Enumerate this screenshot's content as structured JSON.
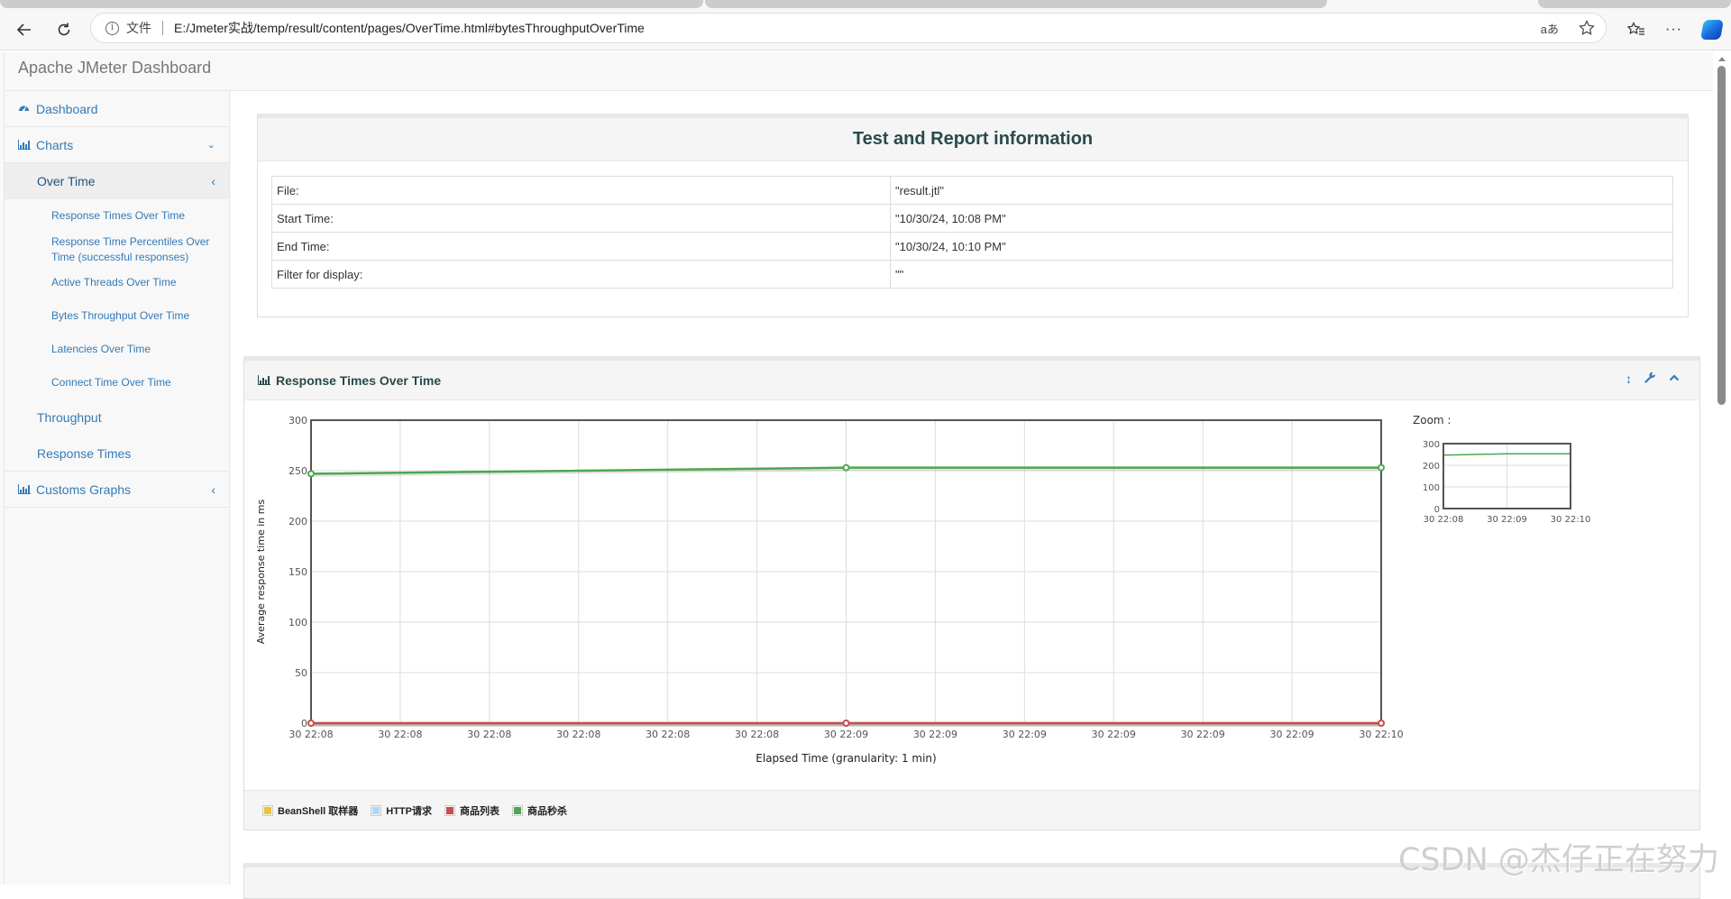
{
  "browser": {
    "file_label": "文件",
    "url": "E:/Jmeter实战/temp/result/content/pages/OverTime.html#bytesThroughputOverTime",
    "reader_label": "aあ"
  },
  "app": {
    "brand": "Apache JMeter Dashboard"
  },
  "sidebar": {
    "dashboard": "Dashboard",
    "charts": "Charts",
    "over_time": "Over Time",
    "over_time_items": [
      "Response Times Over Time",
      "Response Time Percentiles Over Time (successful responses)",
      "Active Threads Over Time",
      "Bytes Throughput Over Time",
      "Latencies Over Time",
      "Connect Time Over Time"
    ],
    "throughput": "Throughput",
    "response_times": "Response Times",
    "custom_graphs": "Customs Graphs"
  },
  "info_panel": {
    "title": "Test and Report information",
    "rows": [
      {
        "key": "File:",
        "value": "\"result.jtl\""
      },
      {
        "key": "Start Time:",
        "value": "\"10/30/24, 10:08 PM\""
      },
      {
        "key": "End Time:",
        "value": "\"10/30/24, 10:10 PM\""
      },
      {
        "key": "Filter for display:",
        "value": "\"\""
      }
    ]
  },
  "chart_panel": {
    "title": "Response Times Over Time",
    "zoom_label": "Zoom :"
  },
  "chart_data": {
    "type": "line",
    "title": "Response Times Over Time",
    "xlabel": "Elapsed Time (granularity: 1 min)",
    "ylabel": "Average response time in ms",
    "ylim": [
      0,
      300
    ],
    "yticks": [
      0,
      50,
      100,
      150,
      200,
      250,
      300
    ],
    "xticks": [
      "30 22:08",
      "30 22:08",
      "30 22:08",
      "30 22:08",
      "30 22:08",
      "30 22:08",
      "30 22:09",
      "30 22:09",
      "30 22:09",
      "30 22:09",
      "30 22:09",
      "30 22:09",
      "30 22:10"
    ],
    "x": [
      "30 22:08",
      "30 22:09",
      "30 22:10"
    ],
    "grid": true,
    "legend_position": "bottom",
    "series": [
      {
        "name": "BeanShell 取样器",
        "color": "#edc240",
        "values": [
          0,
          0,
          0
        ]
      },
      {
        "name": "HTTP请求",
        "color": "#afd8f8",
        "values": [
          0,
          0,
          0
        ]
      },
      {
        "name": "商品列表",
        "color": "#cb4b4b",
        "values": [
          0,
          0,
          0
        ]
      },
      {
        "name": "商品秒杀",
        "color": "#4da74d",
        "values": [
          247,
          253,
          253
        ]
      }
    ],
    "overview": {
      "yticks": [
        0,
        100,
        200,
        300
      ],
      "xticks": [
        "30 22:08",
        "30 22:09",
        "30 22:10"
      ]
    }
  },
  "watermark": "CSDN @杰仔正在努力"
}
